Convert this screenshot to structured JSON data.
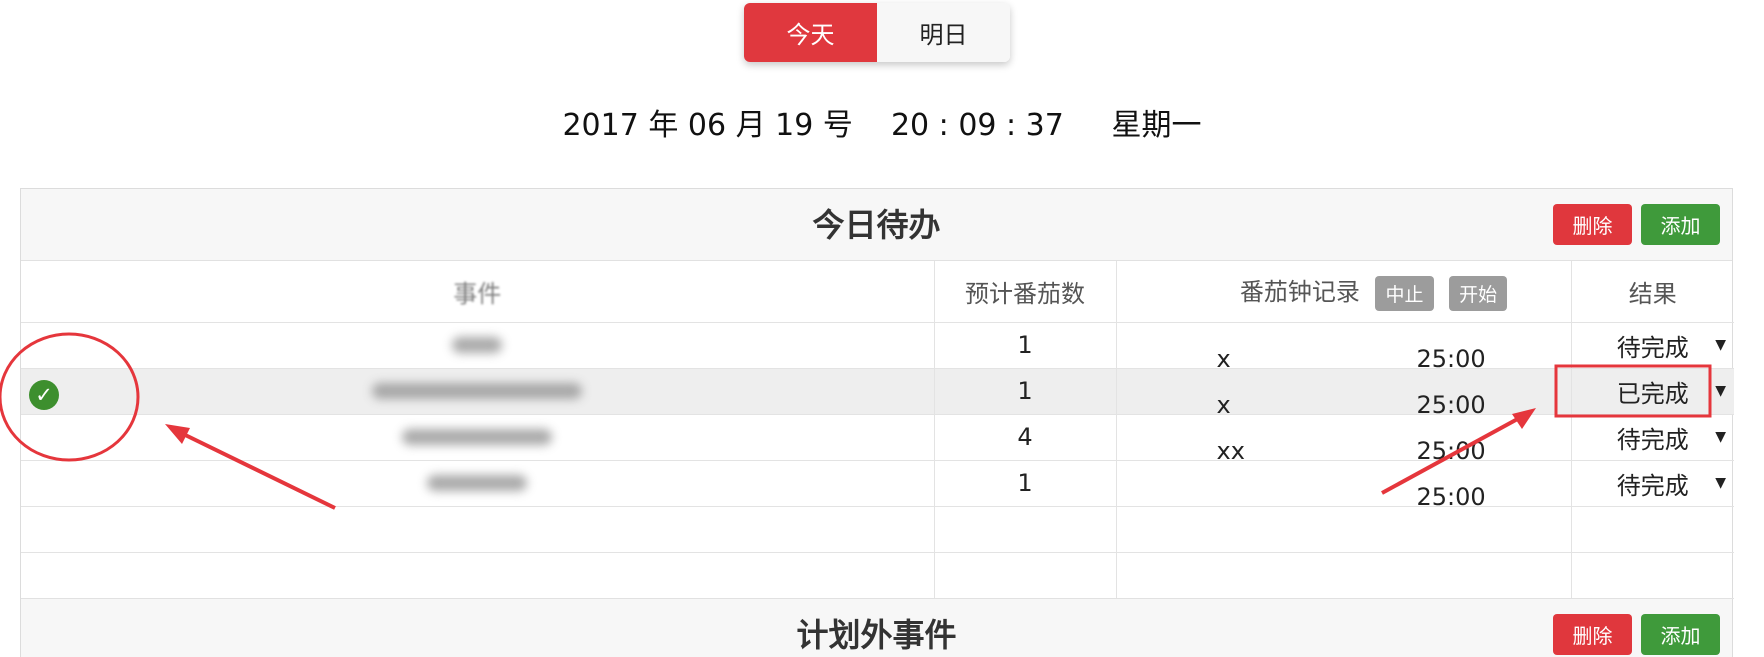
{
  "tabs": [
    {
      "label": "今天",
      "active": true
    },
    {
      "label": "明日",
      "active": false
    }
  ],
  "datetime": "2017 年 06 月 19 号    20 : 09 : 37     星期一",
  "todo_section": {
    "title": "今日待办",
    "delete_label": "删除",
    "add_label": "添加",
    "columns": [
      "事件",
      "预计番茄数",
      "番茄钟记录",
      "结果"
    ],
    "stop_label": "中止",
    "start_label": "开始",
    "rows": [
      {
        "estimate": "1",
        "record": "x",
        "time": "25:00",
        "result": "待完成"
      },
      {
        "estimate": "1",
        "record": "x",
        "time": "25:00",
        "result": "已完成"
      },
      {
        "estimate": "4",
        "record": "xx",
        "time": "25:00",
        "result": "待完成"
      },
      {
        "estimate": "1",
        "record": "",
        "time": "25:00",
        "result": "待完成"
      }
    ],
    "dropdown_glyph": "▼"
  },
  "unplanned_section": {
    "title": "计划外事件",
    "delete_label": "删除",
    "add_label": "添加"
  },
  "colors": {
    "accent_red": "#e0383e",
    "accent_green": "#3f9a3b",
    "annotation_red": "#e5363c"
  }
}
